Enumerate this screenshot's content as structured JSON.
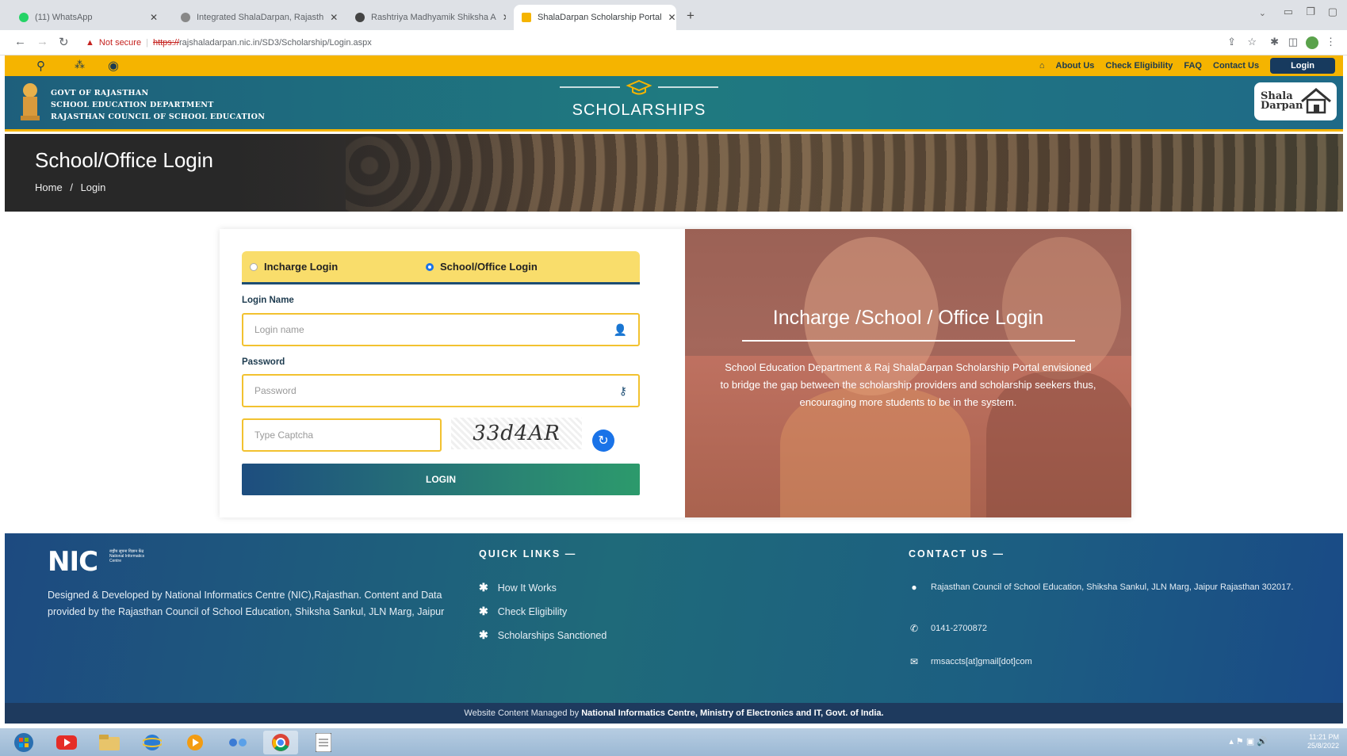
{
  "browser": {
    "tabs": [
      {
        "title": "(11) WhatsApp",
        "favicon_color": "#25d366"
      },
      {
        "title": "Integrated ShalaDarpan, Rajasth",
        "favicon_color": "#888888"
      },
      {
        "title": "Rashtriya Madhyamik Shiksha A",
        "favicon_color": "#444444"
      },
      {
        "title": "ShalaDarpan Scholarship Portal",
        "favicon_color": "#f5b400",
        "active": true
      }
    ],
    "new_tab": "+",
    "security_label": "Not secure",
    "url_scheme": "https://",
    "url_rest": "rajshaladarpan.nic.in/SD3/Scholarship/Login.aspx"
  },
  "topnav": {
    "items": [
      "About Us",
      "Check Eligibility",
      "FAQ",
      "Contact Us"
    ],
    "login": "Login"
  },
  "header": {
    "govt_lines": [
      "GOVT OF RAJASTHAN",
      "SCHOOL EDUCATION DEPARTMENT",
      "RAJASTHAN COUNCIL OF SCHOOL EDUCATION"
    ],
    "portal_title": "SCHOLARSHIPS",
    "logo_line1": "Shala",
    "logo_line2": "Darpan"
  },
  "banner": {
    "title": "School/Office Login",
    "breadcrumb_home": "Home",
    "breadcrumb_sep": "/",
    "breadcrumb_current": "Login"
  },
  "login_form": {
    "tab_incharge": "Incharge Login",
    "tab_school": "School/Office Login",
    "login_name_label": "Login Name",
    "login_name_placeholder": "Login name",
    "password_label": "Password",
    "password_placeholder": "Password",
    "captcha_placeholder": "Type Captcha",
    "captcha_text": "33d4AR",
    "submit": "LOGIN"
  },
  "promo": {
    "title": "Incharge /School / Office Login",
    "description": "School Education Department & Raj ShalaDarpan Scholarship Portal envisioned to bridge the gap between the scholarship providers and scholarship seekers thus, encouraging more students to be in the system."
  },
  "footer": {
    "nic_logo": "NIC",
    "nic_sub": "राष्ट्रीय सूचना विज्ञान केंद्र National Informatics Centre",
    "description": "Designed & Developed by National Informatics Centre (NIC),Rajasthan. Content and Data provided by the Rajasthan Council of School Education, Shiksha Sankul, JLN Marg, Jaipur",
    "quick_links_heading": "QUICK LINKS —",
    "quick_links": [
      "How It Works",
      "Check Eligibility",
      "Scholarships Sanctioned"
    ],
    "contact_heading": "CONTACT US —",
    "address": "Rajasthan Council of School Education, Shiksha Sankul, JLN Marg, Jaipur Rajasthan 302017.",
    "phone": "0141-2700872",
    "email": "rmsaccts[at]gmail[dot]com",
    "bottom_prefix": "Website Content Managed by ",
    "bottom_bold": "National Informatics Centre, Ministry of Electronics and IT, Govt. of India."
  },
  "taskbar": {
    "time": "11:21 PM",
    "date": "25/8/2022"
  },
  "colors": {
    "accent_yellow": "#f5b400",
    "header_teal": "#1f7a80",
    "navy": "#173a5e"
  }
}
